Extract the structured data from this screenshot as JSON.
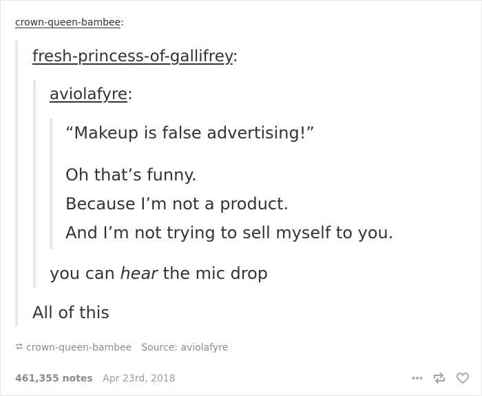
{
  "post": {
    "root_user": "crown-queen-bambee",
    "reblog_user_1": "fresh-princess-of-gallifrey",
    "original_user": "aviolafyre",
    "colon": ":",
    "original_lines": [
      "“Makeup is false advertising!”",
      "Oh that’s funny.",
      "Because I’m not a product.",
      "And I’m not trying to sell myself to you."
    ],
    "reply_2_before": "you can ",
    "reply_2_emph": "hear",
    "reply_2_after": " the mic drop",
    "reply_1": "All of this"
  },
  "meta": {
    "reblogged_from": "crown-queen-bambee",
    "source": "Source: aviolafyre"
  },
  "footer": {
    "notes": "461,355 notes",
    "date": "Apr 23rd, 2018"
  },
  "icons": {
    "reblog_small": "reblog-icon",
    "more": "more-options-icon",
    "reblog": "reblog-icon",
    "like": "heart-icon"
  },
  "colors": {
    "text": "#333333",
    "muted": "#8c8c8c",
    "quote_border": "#e7e7e7"
  }
}
